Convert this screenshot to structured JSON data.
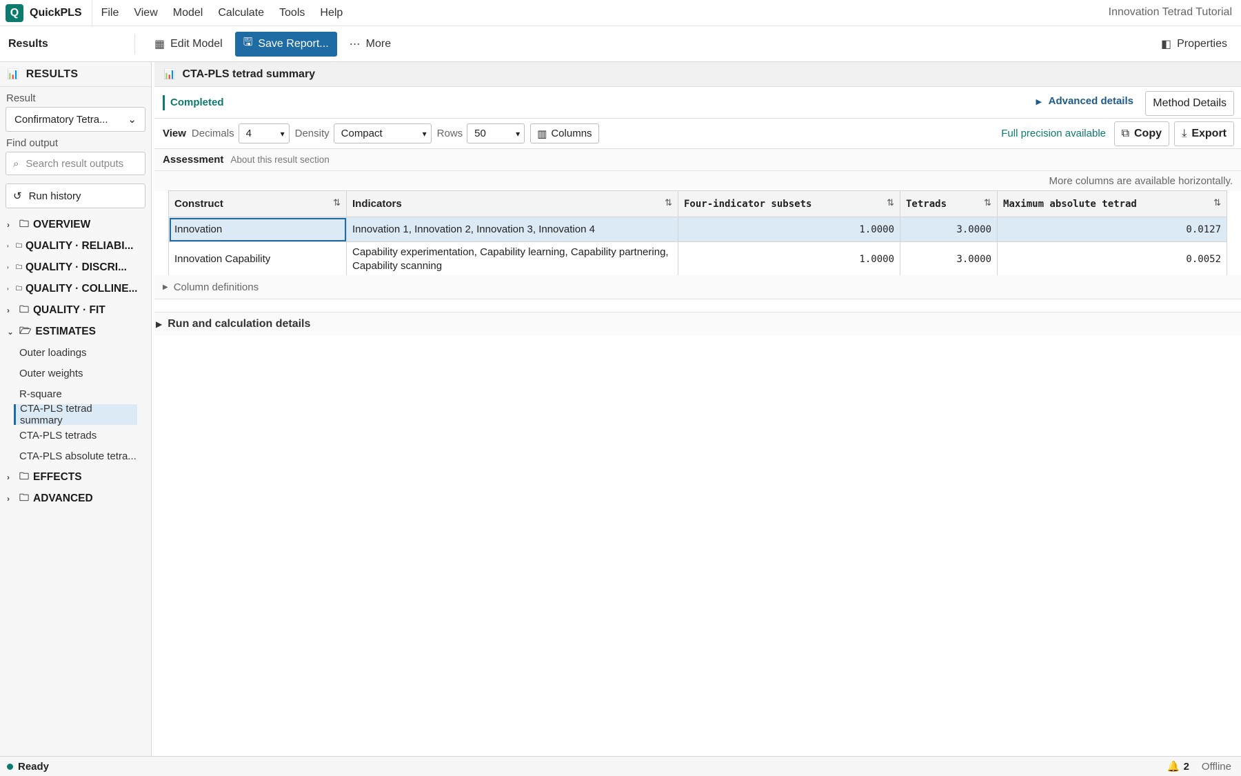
{
  "app": {
    "name": "QuickPLS",
    "logo_letter": "Q",
    "project_title": "Innovation Tetrad Tutorial"
  },
  "menu": [
    "File",
    "View",
    "Model",
    "Calculate",
    "Tools",
    "Help"
  ],
  "toolbar": {
    "title": "Results",
    "edit_model": "Edit Model",
    "save_report": "Save Report...",
    "more": "More",
    "properties": "Properties"
  },
  "sidebar": {
    "heading": "RESULTS",
    "result_label": "Result",
    "result_value": "Confirmatory Tetra...",
    "find_label": "Find output",
    "search_placeholder": "Search result outputs",
    "run_history": "Run history",
    "groups": [
      {
        "label": "OVERVIEW"
      },
      {
        "label": "QUALITY · RELIABI..."
      },
      {
        "label": "QUALITY · DISCRI..."
      },
      {
        "label": "QUALITY · COLLINE..."
      },
      {
        "label": "QUALITY · FIT"
      },
      {
        "label": "ESTIMATES"
      },
      {
        "label": "EFFECTS"
      },
      {
        "label": "ADVANCED"
      }
    ],
    "estimates_items": [
      "Outer loadings",
      "Outer weights",
      "R-square",
      "CTA-PLS tetrad summary",
      "CTA-PLS tetrads",
      "CTA-PLS absolute tetra..."
    ]
  },
  "main": {
    "title": "CTA-PLS tetrad summary",
    "status": "Completed",
    "advanced_details": "Advanced details",
    "method_details": "Method Details",
    "view": {
      "label": "View",
      "decimals_label": "Decimals",
      "decimals_value": "4",
      "density_label": "Density",
      "density_value": "Compact",
      "rows_label": "Rows",
      "rows_value": "50",
      "columns_btn": "Columns",
      "full_precision": "Full precision available",
      "copy": "Copy",
      "export": "Export"
    },
    "assessment": {
      "title": "Assessment",
      "subtitle": "About this result section"
    },
    "more_columns_note": "More columns are available horizontally.",
    "table": {
      "headers": [
        "Construct",
        "Indicators",
        "Four-indicator subsets",
        "Tetrads",
        "Maximum absolute tetrad"
      ],
      "rows": [
        [
          "Innovation",
          "Innovation 1, Innovation 2, Innovation 3, Innovation 4",
          "1.0000",
          "3.0000",
          "0.0127"
        ],
        [
          "Innovation Capability",
          "Capability experimentation, Capability learning, Capability partnering, Capability scanning",
          "1.0000",
          "3.0000",
          "0.0052"
        ]
      ]
    },
    "column_definitions": "Column definitions",
    "run_calc_details": "Run and calculation details"
  },
  "statusbar": {
    "ready": "Ready",
    "notifications": "2",
    "connection": "Offline"
  },
  "colors": {
    "brand": "#0d7a6e",
    "primary": "#1e6ca3",
    "selection": "#dceaf5"
  }
}
